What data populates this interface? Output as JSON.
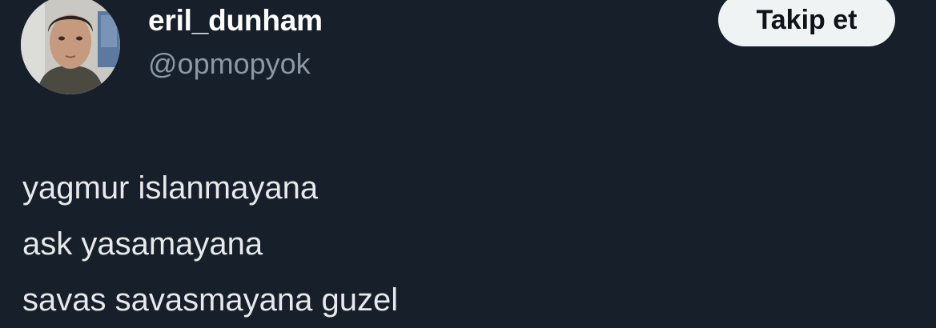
{
  "author": {
    "display_name": "eril_dunham",
    "handle": "@opmopyok"
  },
  "follow_button": {
    "label": "Takip et"
  },
  "tweet": {
    "lines": [
      "yagmur islanmayana",
      "ask yasamayana",
      "savas savasmayana guzel"
    ]
  },
  "colors": {
    "background": "#161f2a",
    "display_name": "#ffffff",
    "handle": "#8b98a5",
    "tweet_text": "#e7e9ea",
    "follow_button_bg": "#eff3f4",
    "follow_button_text": "#0f1419"
  }
}
